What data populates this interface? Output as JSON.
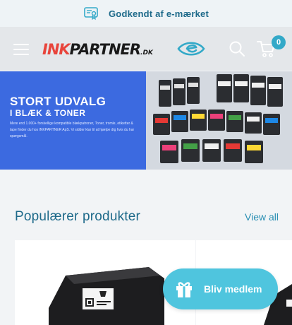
{
  "topbar": {
    "cert_label": "Godkendt af e-mærket"
  },
  "header": {
    "logo_ink": "INK",
    "logo_partner": "PARTNER",
    "logo_dk": ".DK",
    "cart_count": "0"
  },
  "banner": {
    "title": "STORT UDVALG",
    "subtitle": "I BLÆK & TONER",
    "description": "Mere end 1.000+ forskellige kompatible blækpatroner, Toner, tromle, etiketter & tape finder du hos INKPARTNER ApS. Vi sidder klar til at hjælpe dig hvis du har spørgsmål."
  },
  "section": {
    "title": "Populærer produkter",
    "view_all": "View all"
  },
  "member": {
    "label": "Bliv medlem"
  },
  "colors": {
    "accent": "#33a9c8",
    "brand_blue": "#1e6a8a",
    "banner_blue": "#3c6ae0",
    "member_button": "#4fc5de"
  }
}
